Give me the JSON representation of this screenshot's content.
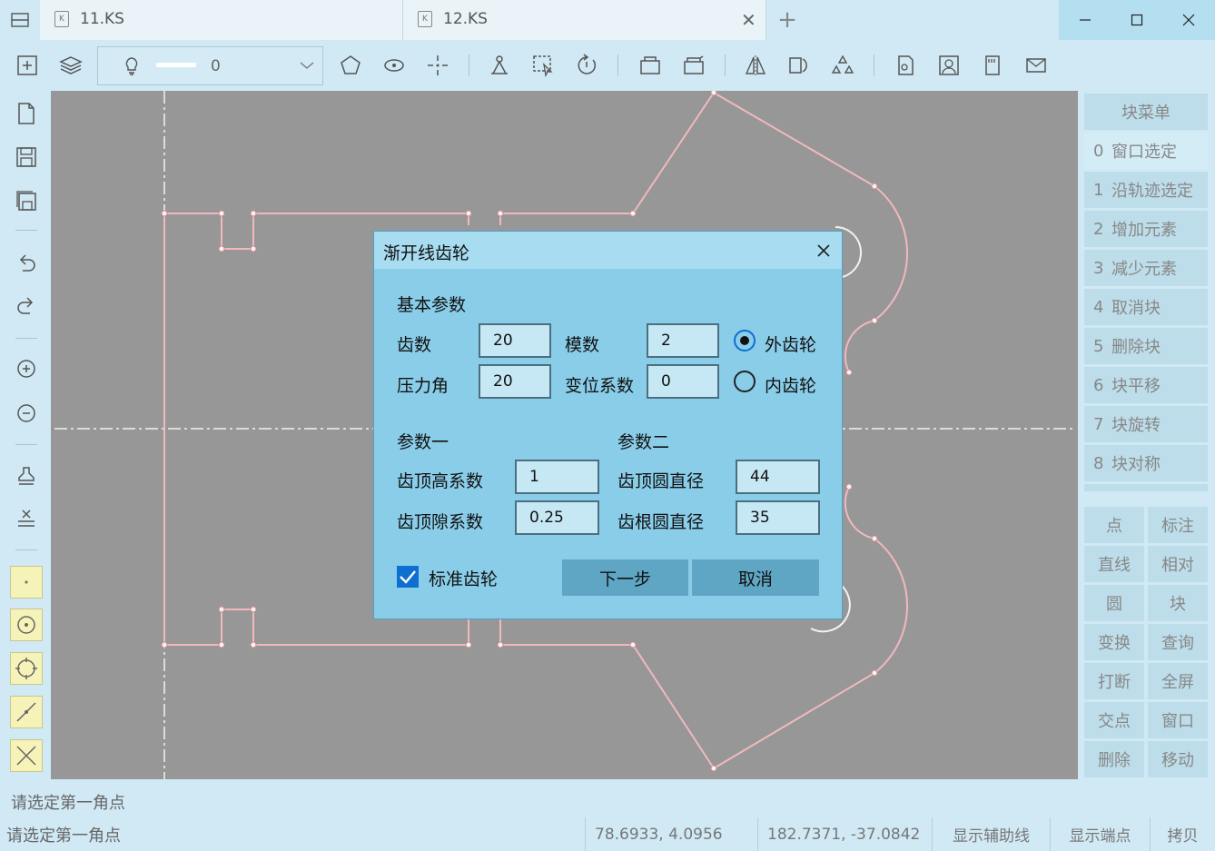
{
  "tabs": [
    {
      "label": "11.KS"
    },
    {
      "label": "12.KS"
    }
  ],
  "layer": {
    "value": "0"
  },
  "right_menu": {
    "header": "块菜单",
    "items": [
      {
        "num": "0",
        "label": "窗口选定"
      },
      {
        "num": "1",
        "label": "沿轨迹选定"
      },
      {
        "num": "2",
        "label": "增加元素"
      },
      {
        "num": "3",
        "label": "减少元素"
      },
      {
        "num": "4",
        "label": "取消块"
      },
      {
        "num": "5",
        "label": "删除块"
      },
      {
        "num": "6",
        "label": "块平移"
      },
      {
        "num": "7",
        "label": "块旋转"
      },
      {
        "num": "8",
        "label": "块对称"
      }
    ],
    "grid": [
      [
        "点",
        "标注"
      ],
      [
        "直线",
        "相对"
      ],
      [
        "圆",
        "块"
      ],
      [
        "变换",
        "查询"
      ],
      [
        "打断",
        "全屏"
      ],
      [
        "交点",
        "窗口"
      ],
      [
        "删除",
        "移动"
      ]
    ]
  },
  "command_line": "请选定第一角点",
  "status": {
    "prompt": "请选定第一角点",
    "coord1": "78.6933, 4.0956",
    "coord2": "182.7371, -37.0842",
    "btn_aux": "显示辅助线",
    "btn_endpoints": "显示端点",
    "btn_copy": "拷贝"
  },
  "dialog": {
    "title": "渐开线齿轮",
    "basic_section": "基本参数",
    "teeth_label": "齿数",
    "teeth_value": "20",
    "module_label": "模数",
    "module_value": "2",
    "pressure_label": "压力角",
    "pressure_value": "20",
    "shift_label": "变位系数",
    "shift_value": "0",
    "external_label": "外齿轮",
    "internal_label": "内齿轮",
    "selected_type": "外齿轮",
    "param1_section": "参数一",
    "param2_section": "参数二",
    "addendum_coef_label": "齿顶高系数",
    "addendum_coef_value": "1",
    "clearance_coef_label": "齿顶隙系数",
    "clearance_coef_value": "0.25",
    "tip_dia_label": "齿顶圆直径",
    "tip_dia_value": "44",
    "root_dia_label": "齿根圆直径",
    "root_dia_value": "35",
    "standard_label": "标准齿轮",
    "standard_checked": true,
    "next_button": "下一步",
    "cancel_button": "取消"
  },
  "colors": {
    "background": "#d0e9f4",
    "canvas": "#979797",
    "drawing_line": "#f2b8bd",
    "dialog": "#8acde9",
    "dialog_button": "#5fa6c4"
  }
}
